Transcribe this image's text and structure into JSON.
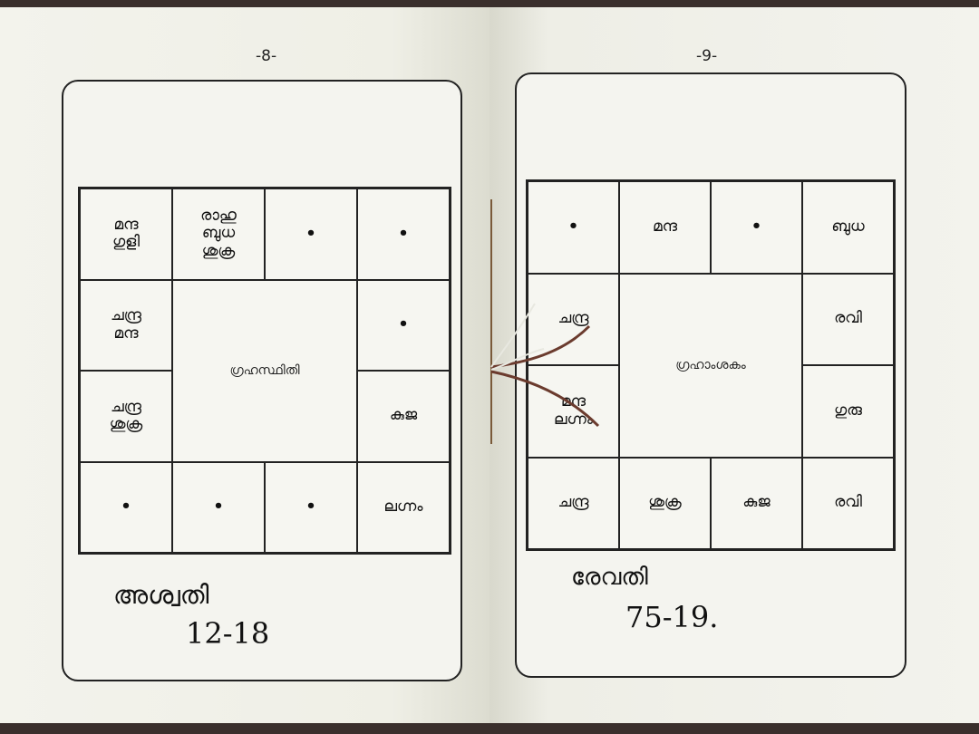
{
  "left_page": {
    "page_number": "-8-",
    "chart_label": "ഗ്രഹസ്ഥിതി",
    "cells": {
      "r1c1": [
        "മന്ദ",
        "ഗുളി"
      ],
      "r1c2": [
        "രാഹു",
        "ബുധ",
        "ശുക്ര"
      ],
      "r1c3": [
        "•"
      ],
      "r1c4": [
        "•"
      ],
      "r2c1": [
        "ചന്ദ്ര",
        "മന്ദ"
      ],
      "r2c4": [
        "•"
      ],
      "r3c1": [
        "ചന്ദ്ര",
        "ശുക്ര"
      ],
      "r3c4": [
        "കുജ"
      ],
      "r4c1": [
        "•"
      ],
      "r4c2": [
        "•"
      ],
      "r4c3": [
        "•"
      ],
      "r4c4": [
        "ലഗ്നം"
      ]
    },
    "footer": [
      "അശ്വതി",
      "12-18"
    ]
  },
  "right_page": {
    "page_number": "-9-",
    "chart_label": "ഗ്രഹാംശകം",
    "cells": {
      "r1c1": [
        "•"
      ],
      "r1c2": [
        "മന്ദ"
      ],
      "r1c3": [
        "•"
      ],
      "r1c4": [
        "ബുധ"
      ],
      "r2c1": [
        "ചന്ദ്ര"
      ],
      "r2c4": [
        "രവി"
      ],
      "r3c1": [
        "മന്ദ",
        "ലഗ്നം"
      ],
      "r3c4": [
        "ഗുരു"
      ],
      "r4c1": [
        "ചന്ദ്ര"
      ],
      "r4c2": [
        "ശുക്ര"
      ],
      "r4c3": [
        "കുജ"
      ],
      "r4c4": [
        "രവി"
      ]
    },
    "footer": [
      "രേവതി",
      "75-19."
    ]
  },
  "colors": {
    "paper": "#f1f1ea",
    "ink": "#111111",
    "thread": "#6b3b2e",
    "background": "#3a2f2c"
  }
}
